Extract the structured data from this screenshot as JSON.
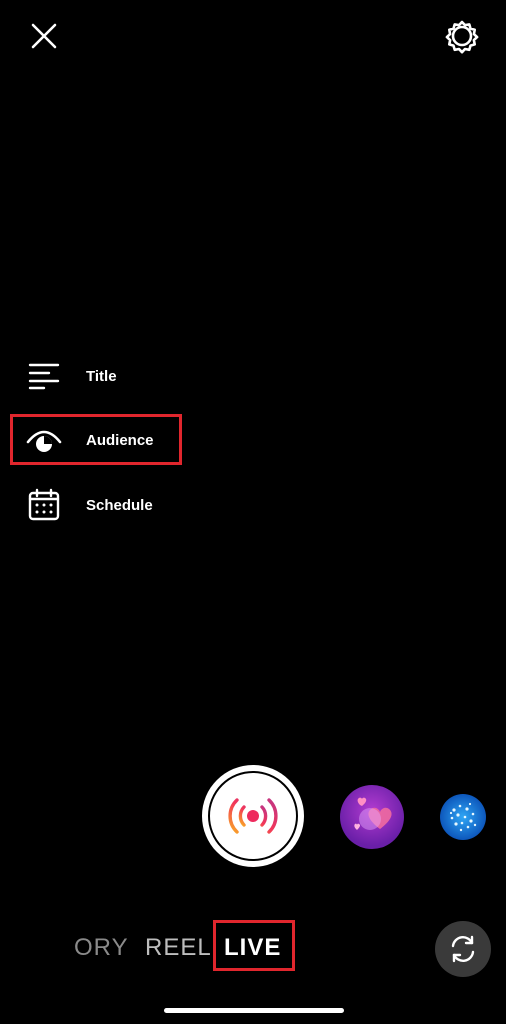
{
  "top_bar": {
    "close_icon": "close-icon",
    "settings_icon": "gear-icon"
  },
  "side_menu": {
    "items": [
      {
        "label": "Title",
        "icon": "text-lines-icon"
      },
      {
        "label": "Audience",
        "icon": "eye-icon"
      },
      {
        "label": "Schedule",
        "icon": "calendar-icon"
      }
    ]
  },
  "modes": {
    "story_partial": "ORY",
    "reel": "REEL",
    "live": "LIVE"
  },
  "capture": {
    "icon": "live-broadcast-icon"
  },
  "effects": [
    {
      "name": "hearts-effect"
    },
    {
      "name": "sparkle-effect"
    }
  ],
  "flip_camera": {
    "icon": "flip-camera-icon"
  },
  "colors": {
    "highlight": "#e0262d",
    "background": "#000000"
  }
}
